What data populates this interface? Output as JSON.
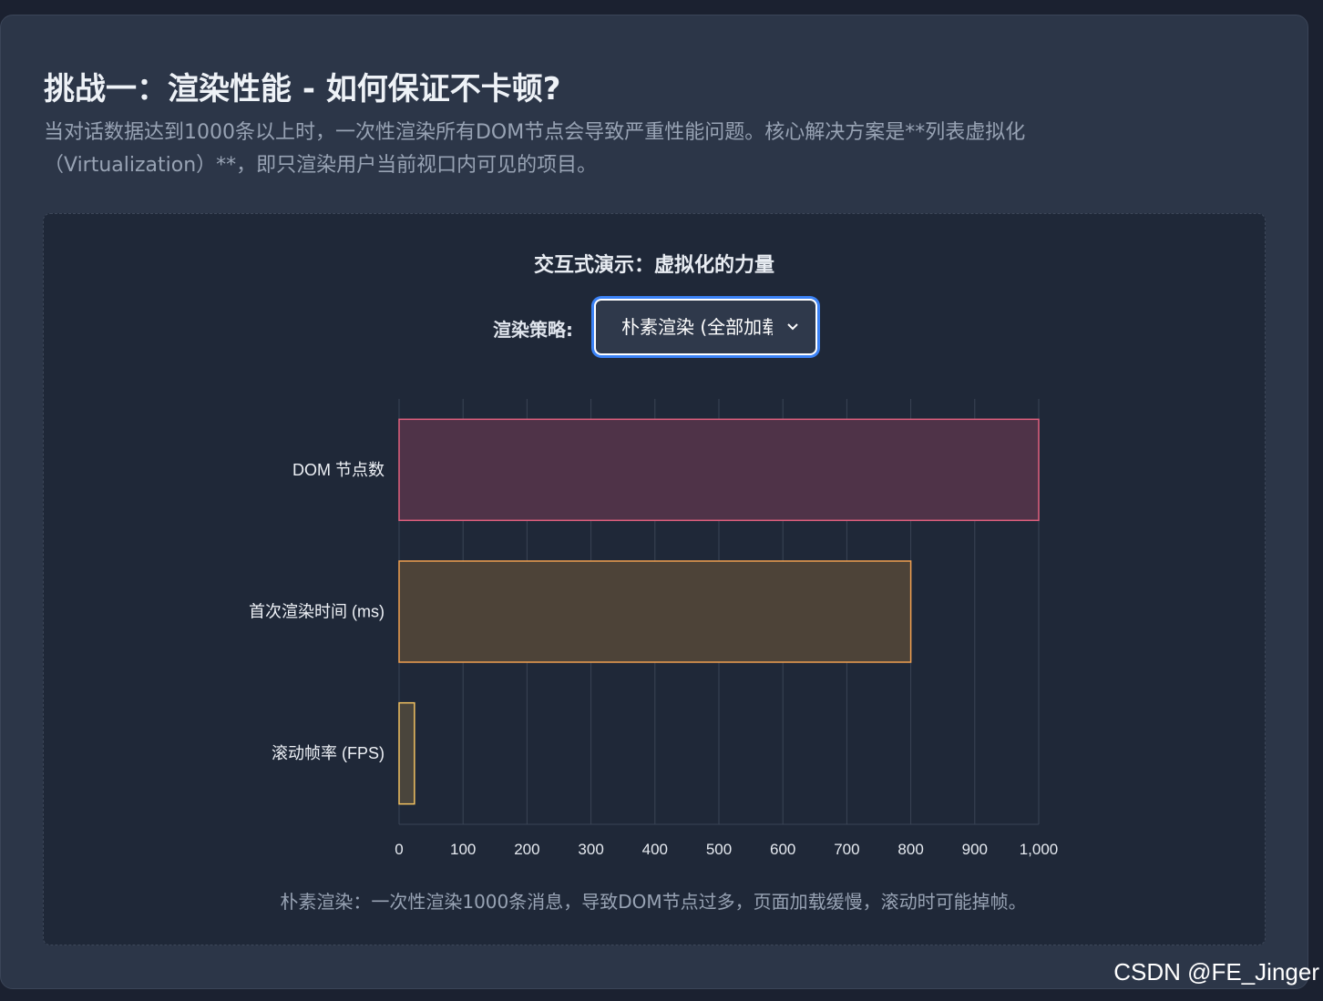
{
  "header": {
    "title": "挑战一：渲染性能 - 如何保证不卡顿?",
    "description": "当对话数据达到1000条以上时，一次性渲染所有DOM节点会导致严重性能问题。核心解决方案是**列表虚拟化（Virtualization）**，即只渲染用户当前视口内可见的项目。"
  },
  "demo": {
    "title": "交互式演示：虚拟化的力量",
    "strategy_label": "渲染策略:",
    "strategy_selected": "朴素渲染 (全部加载)",
    "caption": "朴素渲染：一次性渲染1000条消息，导致DOM节点过多，页面加载缓慢，滚动时可能掉帧。"
  },
  "chart_data": {
    "type": "bar",
    "orientation": "horizontal",
    "categories": [
      "DOM 节点数",
      "首次渲染时间 (ms)",
      "滚动帧率 (FPS)"
    ],
    "values": [
      1000,
      800,
      24
    ],
    "colors": {
      "fills": [
        "#4f3348",
        "#4d4338",
        "#4a453c"
      ],
      "borders": [
        "#e0607e",
        "#f0a050",
        "#f0c060"
      ]
    },
    "xlim": [
      0,
      1000
    ],
    "xticks": [
      "0",
      "100",
      "200",
      "300",
      "400",
      "500",
      "600",
      "700",
      "800",
      "900",
      "1,000"
    ],
    "grid": true
  },
  "watermark": "CSDN @FE_Jinger"
}
